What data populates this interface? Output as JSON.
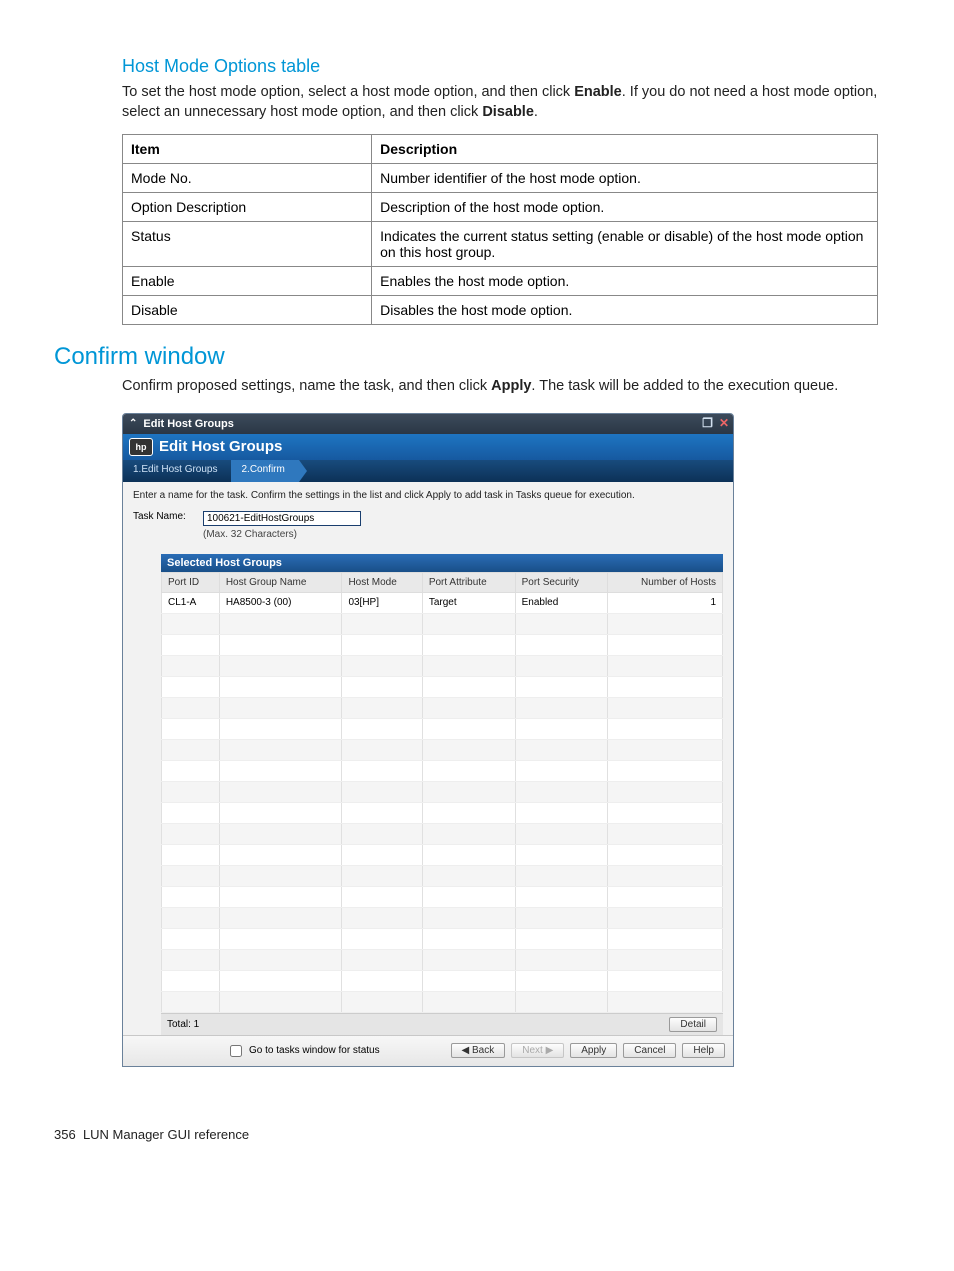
{
  "section1": {
    "title": "Host Mode Options table",
    "intro_parts": [
      "To set the host mode option, select a host mode option, and then click ",
      "Enable",
      ". If you do not need a host mode option, select an unnecessary host mode option, and then click ",
      "Disable",
      "."
    ]
  },
  "doc_table": {
    "headers": [
      "Item",
      "Description"
    ],
    "rows": [
      [
        "Mode No.",
        "Number identifier of the host mode option."
      ],
      [
        "Option Description",
        "Description of the host mode option."
      ],
      [
        "Status",
        "Indicates the current status setting (enable or disable) of the host mode option on this host group."
      ],
      [
        "Enable",
        "Enables the host mode option."
      ],
      [
        "Disable",
        "Disables the host mode option."
      ]
    ]
  },
  "section2": {
    "title": "Confirm window",
    "intro_parts": [
      "Confirm proposed settings, name the task, and then click ",
      "Apply",
      ". The task will be added to the execution queue."
    ]
  },
  "screenshot": {
    "window_title": "Edit Host Groups",
    "header_title": "Edit Host Groups",
    "steps": [
      "1.Edit Host Groups",
      "2.Confirm"
    ],
    "active_step_index": 1,
    "instruction": "Enter a name for the task. Confirm the settings in the list and click Apply to add task in Tasks queue for execution.",
    "task_label": "Task Name:",
    "task_value": "100621-EditHostGroups",
    "task_hint": "(Max. 32 Characters)",
    "grid_title": "Selected Host Groups",
    "grid_headers": [
      "Port ID",
      "Host Group Name",
      "Host Mode",
      "Port Attribute",
      "Port Security",
      "Number of Hosts"
    ],
    "grid_rows": [
      [
        "CL1-A",
        "HA8500-3 (00)",
        "03[HP]",
        "Target",
        "Enabled",
        "1"
      ]
    ],
    "grid_empty_rows": 19,
    "total_label": "Total: 1",
    "detail_btn": "Detail",
    "foot_checkbox": "Go to tasks window for status",
    "buttons": {
      "back": "Back",
      "next": "Next",
      "apply": "Apply",
      "cancel": "Cancel",
      "help": "Help"
    }
  },
  "footer": {
    "page": "356",
    "title": "LUN Manager GUI reference"
  }
}
